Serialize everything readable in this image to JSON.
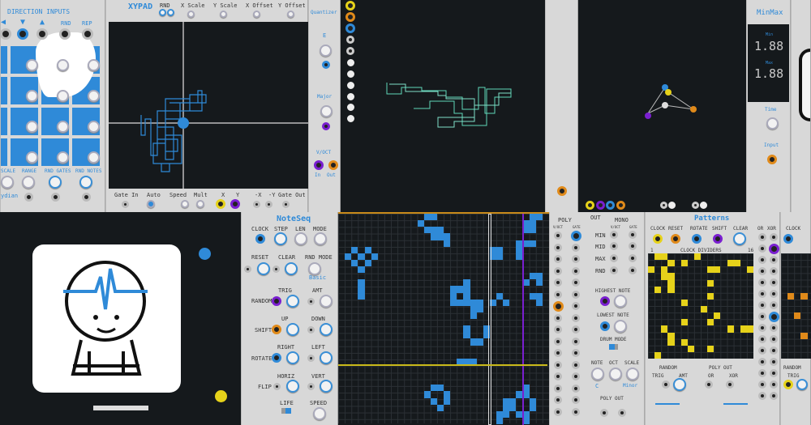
{
  "direction_module": {
    "title": "DIRECTION INPUTS",
    "arrows": [
      "◀",
      "▼",
      "▲"
    ],
    "rnd": "RND",
    "rep": "REP",
    "bottom_labels": [
      "SCALE",
      "RANGE",
      "RND GATES",
      "RND NOTES"
    ],
    "scale_value": "ydian"
  },
  "xypad": {
    "title": "XYPAD",
    "top_labels": [
      "RND",
      "X Scale",
      "Y Scale",
      "X Offset",
      "Y Offset"
    ],
    "bottom_labels": [
      "Gate In",
      "Auto",
      "Speed",
      "Mult",
      "X",
      "Y",
      "-X",
      "-Y",
      "Gate Out"
    ]
  },
  "quantizer": {
    "title": "Quantizer",
    "root": "E",
    "scale": "Major",
    "voct": "V/OCT",
    "in": "In",
    "out": "Out"
  },
  "minmax": {
    "title": "MinMax",
    "min_label": "Min",
    "min_value": "1.88",
    "max_label": "Max",
    "max_value": "1.88",
    "time": "Time",
    "input": "Input"
  },
  "noteseq": {
    "title": "NoteSeq",
    "labels": {
      "clock": "CLOCK",
      "step": "STEP",
      "len": "LEN",
      "mode": "MODE",
      "reset": "RESET",
      "clear": "CLEAR",
      "rnd_mode": "RND MODE",
      "rnd_mode_value": "Basic",
      "trig": "TRIG",
      "amt": "AMT",
      "random": "RANDOM",
      "up": "UP",
      "down": "DOWN",
      "shift": "SHIFT",
      "right": "RIGHT",
      "left": "LEFT",
      "rotate": "ROTATE",
      "horiz": "HORIZ",
      "vert": "VERT",
      "flip": "FLIP",
      "life": "LIFE",
      "speed": "SPEED"
    },
    "cells": [
      [
        13,
        0
      ],
      [
        14,
        0
      ],
      [
        12,
        1
      ],
      [
        13,
        2
      ],
      [
        14,
        2
      ],
      [
        15,
        2
      ],
      [
        14,
        3
      ],
      [
        15,
        3
      ],
      [
        16,
        3
      ],
      [
        16,
        4
      ],
      [
        2,
        5
      ],
      [
        4,
        5
      ],
      [
        1,
        6
      ],
      [
        3,
        6
      ],
      [
        5,
        6
      ],
      [
        2,
        7
      ],
      [
        4,
        7
      ],
      [
        3,
        8
      ],
      [
        3,
        10
      ],
      [
        3,
        11
      ],
      [
        3,
        12
      ],
      [
        19,
        10
      ],
      [
        17,
        11
      ],
      [
        18,
        11
      ],
      [
        19,
        11
      ],
      [
        17,
        12
      ],
      [
        19,
        12
      ],
      [
        17,
        13
      ],
      [
        18,
        13
      ],
      [
        19,
        13
      ],
      [
        20,
        13
      ],
      [
        21,
        13
      ],
      [
        20,
        14
      ],
      [
        21,
        14
      ],
      [
        20,
        15
      ],
      [
        19,
        17
      ],
      [
        22,
        17
      ],
      [
        19,
        18
      ],
      [
        22,
        18
      ],
      [
        20,
        19
      ],
      [
        21,
        19
      ],
      [
        18,
        22
      ],
      [
        19,
        22
      ],
      [
        20,
        22
      ],
      [
        23,
        5
      ],
      [
        24,
        5
      ],
      [
        23,
        6
      ],
      [
        24,
        6
      ],
      [
        27,
        4
      ],
      [
        27,
        5
      ],
      [
        27,
        6
      ],
      [
        29,
        0
      ],
      [
        30,
        0
      ],
      [
        28,
        1
      ],
      [
        29,
        1
      ],
      [
        28,
        2
      ],
      [
        29,
        2
      ],
      [
        28,
        4
      ],
      [
        29,
        4
      ],
      [
        29,
        9
      ],
      [
        30,
        9
      ],
      [
        28,
        10
      ],
      [
        30,
        10
      ],
      [
        29,
        12
      ],
      [
        30,
        12
      ],
      [
        30,
        13
      ],
      [
        24,
        12
      ],
      [
        23,
        13
      ],
      [
        25,
        13
      ],
      [
        14,
        26
      ],
      [
        15,
        26
      ],
      [
        13,
        27
      ],
      [
        16,
        27
      ],
      [
        14,
        28
      ],
      [
        16,
        28
      ],
      [
        15,
        29
      ],
      [
        28,
        26
      ],
      [
        27,
        27
      ],
      [
        28,
        27
      ],
      [
        25,
        28
      ],
      [
        26,
        28
      ],
      [
        29,
        28
      ],
      [
        25,
        29
      ],
      [
        26,
        29
      ],
      [
        29,
        29
      ],
      [
        24,
        30
      ],
      [
        25,
        30
      ],
      [
        27,
        30
      ],
      [
        28,
        30
      ],
      [
        24,
        31
      ],
      [
        28,
        31
      ]
    ],
    "grid_cols": 32,
    "grid_rows": 32
  },
  "poly_module": {
    "poly": "POLY",
    "out": "OUT",
    "mono": "MONO",
    "voct": "V/OCT",
    "gate": "GATE",
    "mono_rows": [
      "MIN",
      "MID",
      "MAX",
      "RND"
    ],
    "highest_note": "HIGHEST NOTE",
    "lowest_note": "LOWEST NOTE",
    "drum_mode": "DRUM MODE",
    "note": "NOTE",
    "oct": "OCT",
    "scale": "SCALE",
    "note_value": "C",
    "scale_value": "Minor",
    "poly_out": "POLY OUT"
  },
  "patterns": {
    "title": "Patterns",
    "inputs": [
      "CLOCK",
      "RESET",
      "ROTATE",
      "SHIFT",
      "CLEAR"
    ],
    "or": "OR",
    "xor": "XOR",
    "divider_start": "1",
    "divider_label": "CLOCK DIVIDERS",
    "divider_end": "16",
    "random": "RANDOM",
    "poly_out": "POLY OUT",
    "trig": "TRIG",
    "amt": "AMT",
    "cells": [
      [
        1,
        0
      ],
      [
        2,
        0
      ],
      [
        7,
        0
      ],
      [
        3,
        1
      ],
      [
        5,
        1
      ],
      [
        12,
        1
      ],
      [
        13,
        1
      ],
      [
        0,
        2
      ],
      [
        2,
        2
      ],
      [
        9,
        2
      ],
      [
        10,
        2
      ],
      [
        15,
        2
      ],
      [
        2,
        3
      ],
      [
        3,
        3
      ],
      [
        3,
        4
      ],
      [
        9,
        4
      ],
      [
        1,
        5
      ],
      [
        3,
        5
      ],
      [
        9,
        6
      ],
      [
        5,
        7
      ],
      [
        8,
        8
      ],
      [
        10,
        9
      ],
      [
        5,
        10
      ],
      [
        9,
        10
      ],
      [
        2,
        11
      ],
      [
        12,
        11
      ],
      [
        14,
        11
      ],
      [
        15,
        11
      ],
      [
        3,
        12
      ],
      [
        3,
        13
      ],
      [
        5,
        13
      ],
      [
        6,
        14
      ],
      [
        9,
        14
      ],
      [
        1,
        15
      ]
    ]
  },
  "right_module": {
    "clock": "CLOCK",
    "random": "RANDOM",
    "trig": "TRIG"
  },
  "colors": {
    "accent_blue": "#2f8ad8",
    "yellow": "#e6d21a",
    "orange": "#e08a1a",
    "purple": "#7a1fd0",
    "panel": "#d8d8d8",
    "screen": "#15191c"
  }
}
